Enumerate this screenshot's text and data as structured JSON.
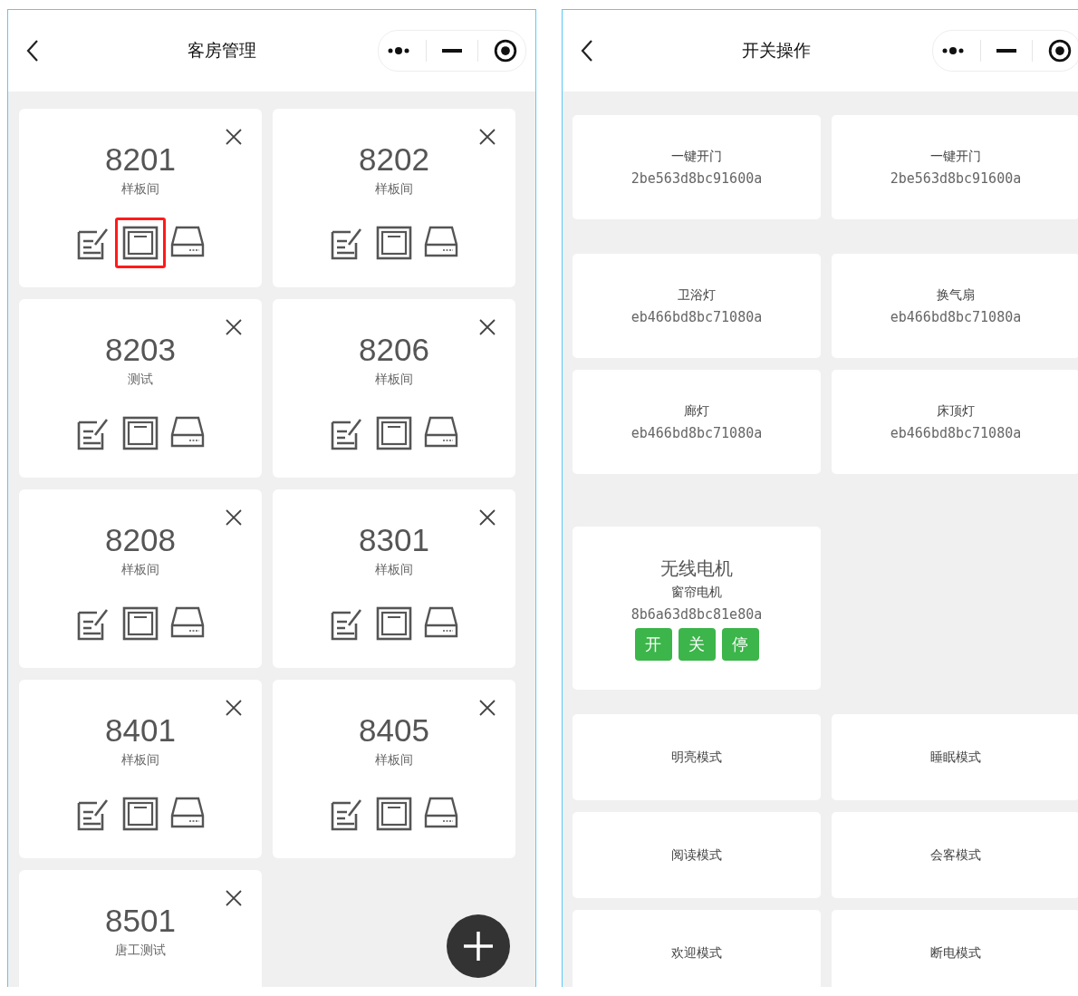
{
  "rooms_screen": {
    "title": "客房管理",
    "rooms": [
      {
        "number": "8201",
        "type": "样板间",
        "highlighted": true
      },
      {
        "number": "8202",
        "type": "样板间",
        "highlighted": false
      },
      {
        "number": "8203",
        "type": "测试",
        "highlighted": false
      },
      {
        "number": "8206",
        "type": "样板间",
        "highlighted": false
      },
      {
        "number": "8208",
        "type": "样板间",
        "highlighted": false
      },
      {
        "number": "8301",
        "type": "样板间",
        "highlighted": false
      },
      {
        "number": "8401",
        "type": "样板间",
        "highlighted": false
      },
      {
        "number": "8405",
        "type": "样板间",
        "highlighted": false
      },
      {
        "number": "8501",
        "type": "唐工测试",
        "highlighted": false
      }
    ]
  },
  "switch_screen": {
    "title": "开关操作",
    "sections": [
      {
        "items": [
          {
            "kind": "device",
            "name": "一键开门",
            "id": "2be563d8bc91600a"
          },
          {
            "kind": "device",
            "name": "一键开门",
            "id": "2be563d8bc91600a"
          }
        ]
      },
      {
        "items": [
          {
            "kind": "device",
            "name": "卫浴灯",
            "id": "eb466bd8bc71080a"
          },
          {
            "kind": "device",
            "name": "换气扇",
            "id": "eb466bd8bc71080a"
          },
          {
            "kind": "device",
            "name": "廊灯",
            "id": "eb466bd8bc71080a"
          },
          {
            "kind": "device",
            "name": "床顶灯",
            "id": "eb466bd8bc71080a"
          }
        ]
      },
      {
        "items": [
          {
            "kind": "motor",
            "title": "无线电机",
            "name": "窗帘电机",
            "id": "8b6a63d8bc81e80a",
            "buttons": [
              "开",
              "关",
              "停"
            ]
          }
        ]
      },
      {
        "items": [
          {
            "kind": "scene",
            "name": "明亮模式"
          },
          {
            "kind": "scene",
            "name": "睡眠模式"
          },
          {
            "kind": "scene",
            "name": "阅读模式"
          },
          {
            "kind": "scene",
            "name": "会客模式"
          },
          {
            "kind": "scene",
            "name": "欢迎模式"
          },
          {
            "kind": "scene",
            "name": "断电模式"
          }
        ]
      }
    ]
  }
}
